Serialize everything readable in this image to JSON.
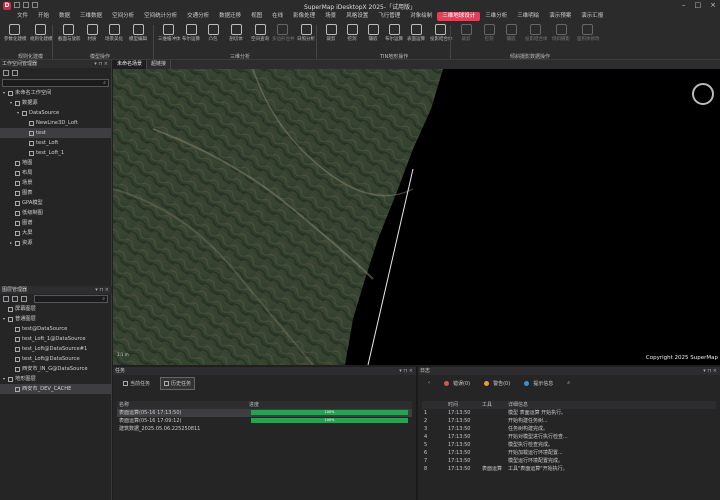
{
  "app": {
    "title": "SuperMap iDesktopX 2025-「试用版」",
    "logo": "D"
  },
  "menu": [
    "文件",
    "开始",
    "数据",
    "三维数据",
    "空间分析",
    "空间统计分析",
    "交通分析",
    "数据迁移",
    "视图",
    "在线",
    "影像处理",
    "场景",
    "风格设置",
    "飞行管理",
    "对象绘制",
    "三维地球设计",
    "三维分析",
    "三维明绘",
    "演示预案",
    "演示汇报"
  ],
  "menu_active_index": 15,
  "ribbon": {
    "buttons": [
      {
        "label": "参数化建模",
        "dim": false
      },
      {
        "label": "规则化建模",
        "dim": false
      },
      {
        "label": "截面与放影",
        "dim": false
      },
      {
        "label": "材质",
        "dim": false
      },
      {
        "label": "场景美化",
        "dim": false
      },
      {
        "label": "模型编辑",
        "dim": false
      },
      {
        "label": "三维缓冲体",
        "dim": false
      },
      {
        "label": "布尔运算",
        "dim": false
      },
      {
        "label": "凸包",
        "dim": false
      },
      {
        "label": "剖切体",
        "dim": false
      },
      {
        "label": "空间查询",
        "dim": false
      },
      {
        "label": "多边形合并",
        "dim": true
      },
      {
        "label": "日照分析",
        "dim": false
      },
      {
        "label": "裁剪",
        "dim": false
      },
      {
        "label": "挖洞",
        "dim": false
      },
      {
        "label": "镶嵌",
        "dim": false
      },
      {
        "label": "布尔运算",
        "dim": false
      },
      {
        "label": "表面运算",
        "dim": false
      },
      {
        "label": "投影结合体",
        "dim": false
      },
      {
        "label": "裁剪",
        "dim": true
      },
      {
        "label": "挖洞",
        "dim": true
      },
      {
        "label": "镶嵌",
        "dim": true
      },
      {
        "label": "投影结合体",
        "dim": true
      },
      {
        "label": "倾斜摄影",
        "dim": true
      },
      {
        "label": "面积体修改",
        "dim": true
      }
    ],
    "groups": [
      "规则化建模",
      "模型操作",
      "三维分析",
      "TIN地形操作",
      "倾斜摄影数据操作"
    ]
  },
  "workspace": {
    "title": "工作空间管理器",
    "search_placeholder": "",
    "tree": [
      {
        "label": "未命名工作空间",
        "level": 0,
        "arrow": "▾",
        "sel": false
      },
      {
        "label": "数据源",
        "level": 1,
        "arrow": "▾",
        "sel": false
      },
      {
        "label": "DataSource",
        "level": 2,
        "arrow": "▾",
        "sel": false
      },
      {
        "label": "NewLine3D_Loft",
        "level": 3,
        "arrow": "",
        "sel": false
      },
      {
        "label": "test",
        "level": 3,
        "arrow": "",
        "sel": true
      },
      {
        "label": "test_Loft",
        "level": 3,
        "arrow": "",
        "sel": false
      },
      {
        "label": "test_Loft_1",
        "level": 3,
        "arrow": "",
        "sel": false
      },
      {
        "label": "地图",
        "level": 1,
        "arrow": "",
        "sel": false
      },
      {
        "label": "布局",
        "level": 1,
        "arrow": "",
        "sel": false
      },
      {
        "label": "场景",
        "level": 1,
        "arrow": "",
        "sel": false
      },
      {
        "label": "图表",
        "level": 1,
        "arrow": "",
        "sel": false
      },
      {
        "label": "GPA模型",
        "level": 1,
        "arrow": "",
        "sel": false
      },
      {
        "label": "低级制图",
        "level": 1,
        "arrow": "",
        "sel": false
      },
      {
        "label": "图谱",
        "level": 1,
        "arrow": "",
        "sel": false
      },
      {
        "label": "大屏",
        "level": 1,
        "arrow": "",
        "sel": false
      },
      {
        "label": "资源",
        "level": 1,
        "arrow": "▸",
        "sel": false
      }
    ]
  },
  "layers": {
    "title": "图层管理器",
    "tree": [
      {
        "label": "屏幕图层",
        "level": 0,
        "arrow": "",
        "sel": false
      },
      {
        "label": "普通图层",
        "level": 0,
        "arrow": "▾",
        "sel": false
      },
      {
        "label": "test@DataSource",
        "level": 1,
        "arrow": "",
        "sel": false
      },
      {
        "label": "test_Loft_1@DataSource",
        "level": 1,
        "arrow": "",
        "sel": false
      },
      {
        "label": "test_Loft@DataSource#1",
        "level": 1,
        "arrow": "",
        "sel": false
      },
      {
        "label": "test_Loft@DataSource",
        "level": 1,
        "arrow": "",
        "sel": false
      },
      {
        "label": "西安市_IN_G@DataSource",
        "level": 1,
        "arrow": "",
        "sel": false
      },
      {
        "label": "地形图层",
        "level": 0,
        "arrow": "▾",
        "sel": false
      },
      {
        "label": "西安市_DEV_CACHE",
        "level": 1,
        "arrow": "",
        "sel": true
      }
    ]
  },
  "map": {
    "tabs": [
      "未命名场景",
      "超链接"
    ],
    "active_tab": 0,
    "copyright": "Copyright 2025 SuperMap",
    "scale": "1:1 m"
  },
  "tasks": {
    "title": "任务",
    "buttons": [
      "当前任务",
      "历史任务"
    ],
    "active_button": 1,
    "columns": [
      "名称",
      "进度"
    ],
    "rows": [
      {
        "name": "表面运算(05-16 17:13:50)",
        "progress": "100%",
        "sel": true
      },
      {
        "name": "表面运算(05-16 17:09:12)",
        "progress": "100%",
        "sel": false
      },
      {
        "name": "建筑数据_2025.05.06.225250811",
        "progress": "",
        "sel": false
      }
    ]
  },
  "log": {
    "title": "日志",
    "filters": [
      {
        "label": "错误(0)",
        "color": "#d9534f"
      },
      {
        "label": "警告(0)",
        "color": "#e0a030"
      },
      {
        "label": "提示信息",
        "color": "#3a8fd8"
      }
    ],
    "columns": [
      "",
      "时间",
      "工具",
      "详细信息"
    ],
    "rows": [
      {
        "n": "1",
        "time": "17:13:50",
        "tool": "",
        "msg": "模型 表面运算 开始执行。"
      },
      {
        "n": "2",
        "time": "17:13:50",
        "tool": "",
        "msg": "开始构建任务树..."
      },
      {
        "n": "3",
        "time": "17:13:50",
        "tool": "",
        "msg": "任务树构建完成。"
      },
      {
        "n": "4",
        "time": "17:13:50",
        "tool": "",
        "msg": "开始对模型进行执行检查..."
      },
      {
        "n": "5",
        "time": "17:13:50",
        "tool": "",
        "msg": "模型执行检查完成。"
      },
      {
        "n": "6",
        "time": "17:13:50",
        "tool": "",
        "msg": "开始加载运行环境配置..."
      },
      {
        "n": "7",
        "time": "17:13:50",
        "tool": "",
        "msg": "模型运行环境配置完成。"
      },
      {
        "n": "8",
        "time": "17:13:50",
        "tool": "表面运算",
        "msg": "工具\"表面运算\"开始执行。"
      }
    ]
  }
}
